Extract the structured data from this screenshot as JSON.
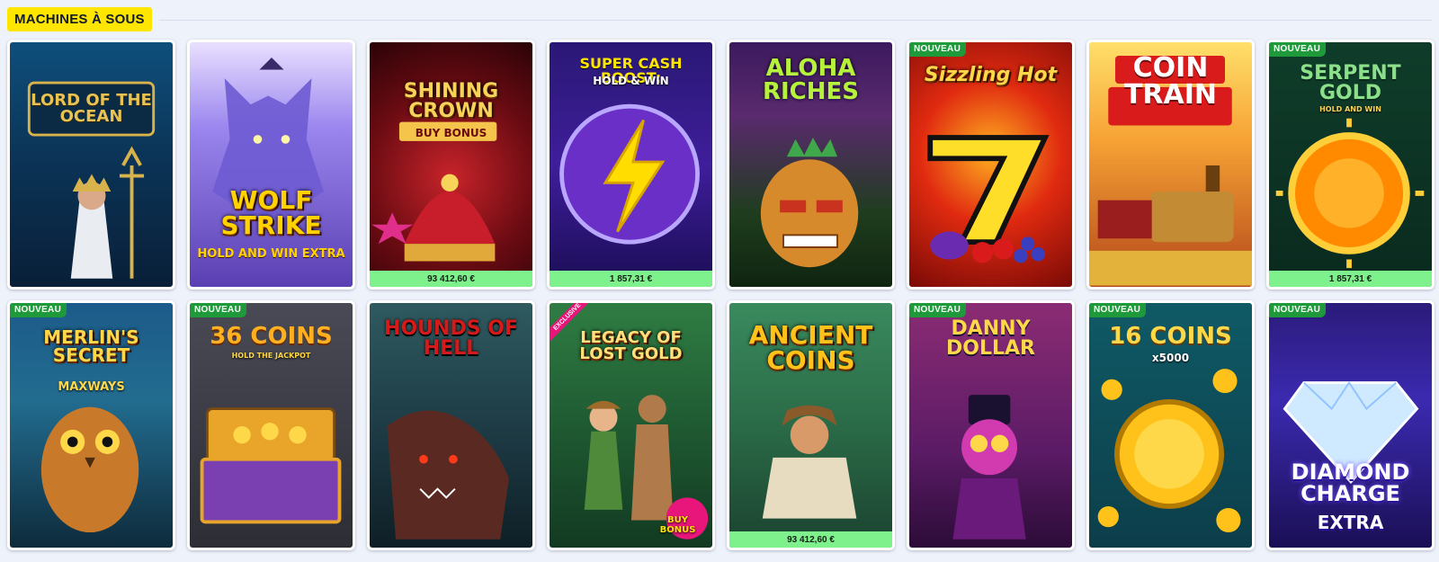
{
  "section": {
    "title": "MACHINES À SOUS"
  },
  "labels": {
    "new_badge": "NOUVEAU",
    "exclusive_ribbon": "EXCLUSIVE"
  },
  "games": [
    {
      "id": "lord-of-the-ocean",
      "title": "LORD OF THE OCEAN",
      "new": false,
      "jackpot": null
    },
    {
      "id": "wolf-strike",
      "title": "WOLF STRIKE",
      "subtitle": "HOLD AND WIN EXTRA",
      "new": false,
      "jackpot": null
    },
    {
      "id": "shining-crown",
      "title": "SHINING CROWN",
      "subtitle": "BUY BONUS",
      "new": false,
      "jackpot": "93 412,60 €"
    },
    {
      "id": "super-cash-boost",
      "title": "SUPER CASH BOOST:",
      "subtitle": "HOLD & WIN",
      "new": false,
      "jackpot": "1 857,31 €"
    },
    {
      "id": "aloha-riches",
      "title": "ALOHA RICHES",
      "new": false,
      "jackpot": null
    },
    {
      "id": "sizzling-hot",
      "title": "Sizzling Hot",
      "new": true,
      "jackpot": null
    },
    {
      "id": "coin-train",
      "title": "COIN TRAIN",
      "new": false,
      "jackpot": null
    },
    {
      "id": "serpent-gold",
      "title": "SERPENT GOLD",
      "subtitle": "HOLD AND WIN",
      "new": true,
      "jackpot": "1 857,31 €"
    },
    {
      "id": "merlins-secret",
      "title": "MERLIN'S SECRET",
      "subtitle": "MAXWAYS",
      "new": true,
      "jackpot": null
    },
    {
      "id": "36-coins",
      "title": "36 COINS",
      "subtitle": "HOLD THE JACKPOT",
      "new": true,
      "jackpot": null
    },
    {
      "id": "hounds-of-hell",
      "title": "HOUNDS OF HELL",
      "new": false,
      "jackpot": null
    },
    {
      "id": "legacy-of-lost-gold",
      "title": "LEGACY OF LOST GOLD",
      "subtitle": "BUY BONUS",
      "new": false,
      "exclusive": true,
      "jackpot": null
    },
    {
      "id": "ancient-coins",
      "title": "ANCIENT COINS",
      "new": false,
      "jackpot": "93 412,60 €"
    },
    {
      "id": "danny-dollar",
      "title": "DANNY DOLLAR",
      "new": true,
      "jackpot": null
    },
    {
      "id": "16-coins",
      "title": "16 COINS",
      "subtitle": "x5000",
      "new": true,
      "jackpot": null
    },
    {
      "id": "diamond-charge-extra",
      "title": "DIAMOND CHARGE",
      "subtitle": "EXTRA",
      "new": true,
      "jackpot": null
    }
  ],
  "colors": {
    "section_title_bg": "#ffe600",
    "new_badge_bg": "#1f9a3a",
    "jackpot_bar_bg": "#7ef08c",
    "page_bg": "#eef2fa"
  }
}
